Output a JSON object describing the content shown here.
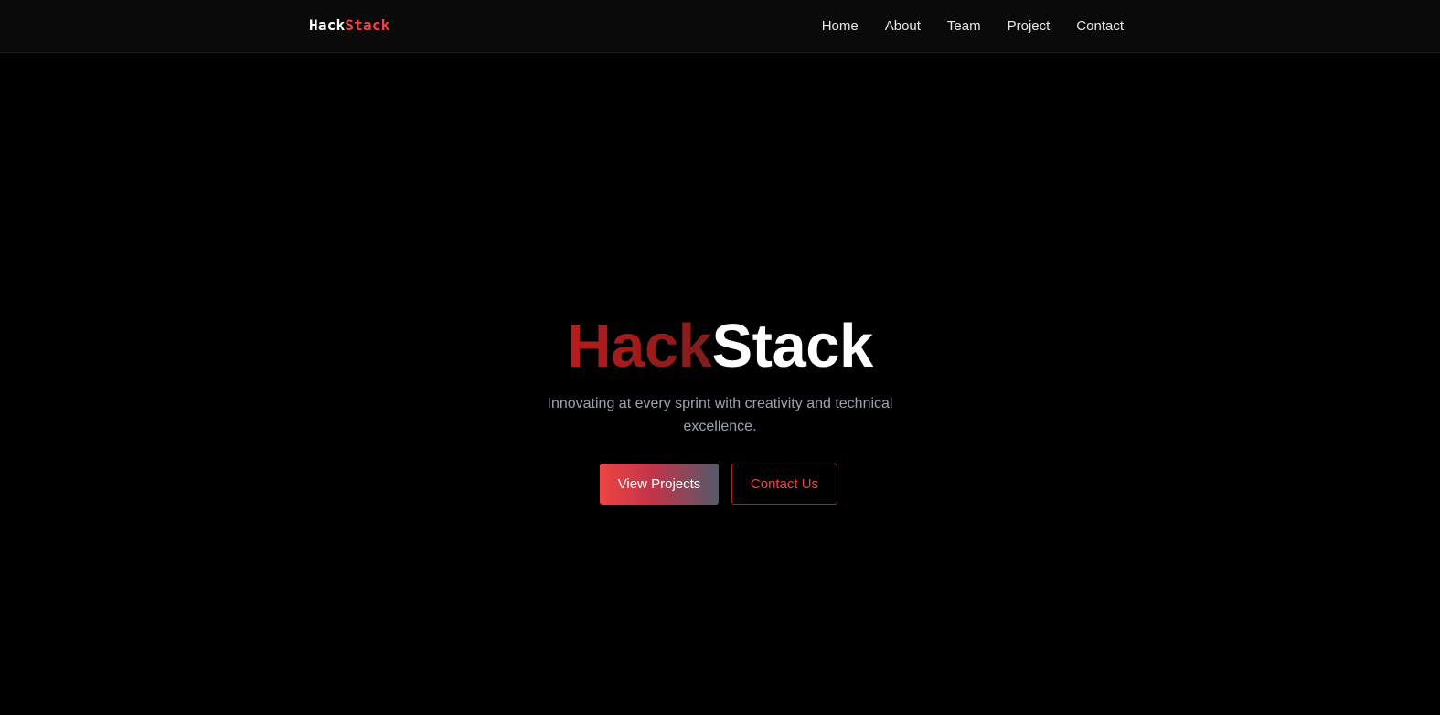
{
  "brand": {
    "part1": "Hack",
    "part2": "Stack"
  },
  "nav": {
    "items": [
      {
        "label": "Home"
      },
      {
        "label": "About"
      },
      {
        "label": "Team"
      },
      {
        "label": "Project"
      },
      {
        "label": "Contact"
      }
    ]
  },
  "hero": {
    "title_part1": "Hack",
    "title_part2": "Stack",
    "subtitle": "Innovating at every sprint with creativity and technical excellence.",
    "primary_button": "View Projects",
    "secondary_button": "Contact Us"
  },
  "colors": {
    "background": "#000000",
    "navbar": "#0a0a0a",
    "accent": "#ef4444",
    "title_red": "#b91c1c",
    "subtitle": "#9ca3af"
  }
}
